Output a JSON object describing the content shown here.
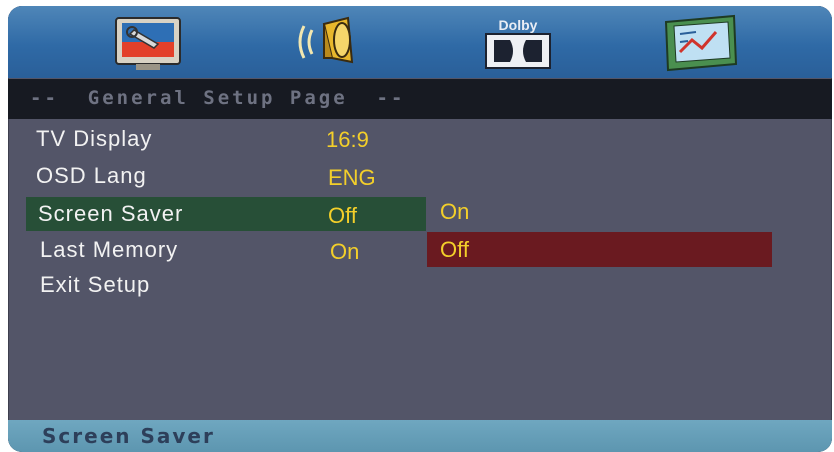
{
  "icons": [
    {
      "name": "general-setup-icon"
    },
    {
      "name": "audio-speaker-icon"
    },
    {
      "name": "dolby-digital-icon",
      "text": "Dolby"
    },
    {
      "name": "preferences-icon"
    }
  ],
  "title": "--  General Setup Page  --",
  "menu": [
    {
      "label": "TV Display",
      "value": "16:9"
    },
    {
      "label": "OSD Lang",
      "value": "ENG"
    },
    {
      "label": "Screen Saver",
      "value": "Off"
    },
    {
      "label": "Last Memory",
      "value": "On"
    },
    {
      "label": "Exit Setup",
      "value": ""
    }
  ],
  "submenu": {
    "options": [
      "On",
      "Off"
    ],
    "selected": "Off"
  },
  "status": "Screen Saver",
  "colors": {
    "background": "#535568",
    "icon_bar": "#2f6aa6",
    "title_bar": "#171a22",
    "value_text": "#f3cf2a",
    "row_highlight": "#274f37",
    "option_highlight": "#6a1a20",
    "status_bar": "#6fa7c0"
  }
}
